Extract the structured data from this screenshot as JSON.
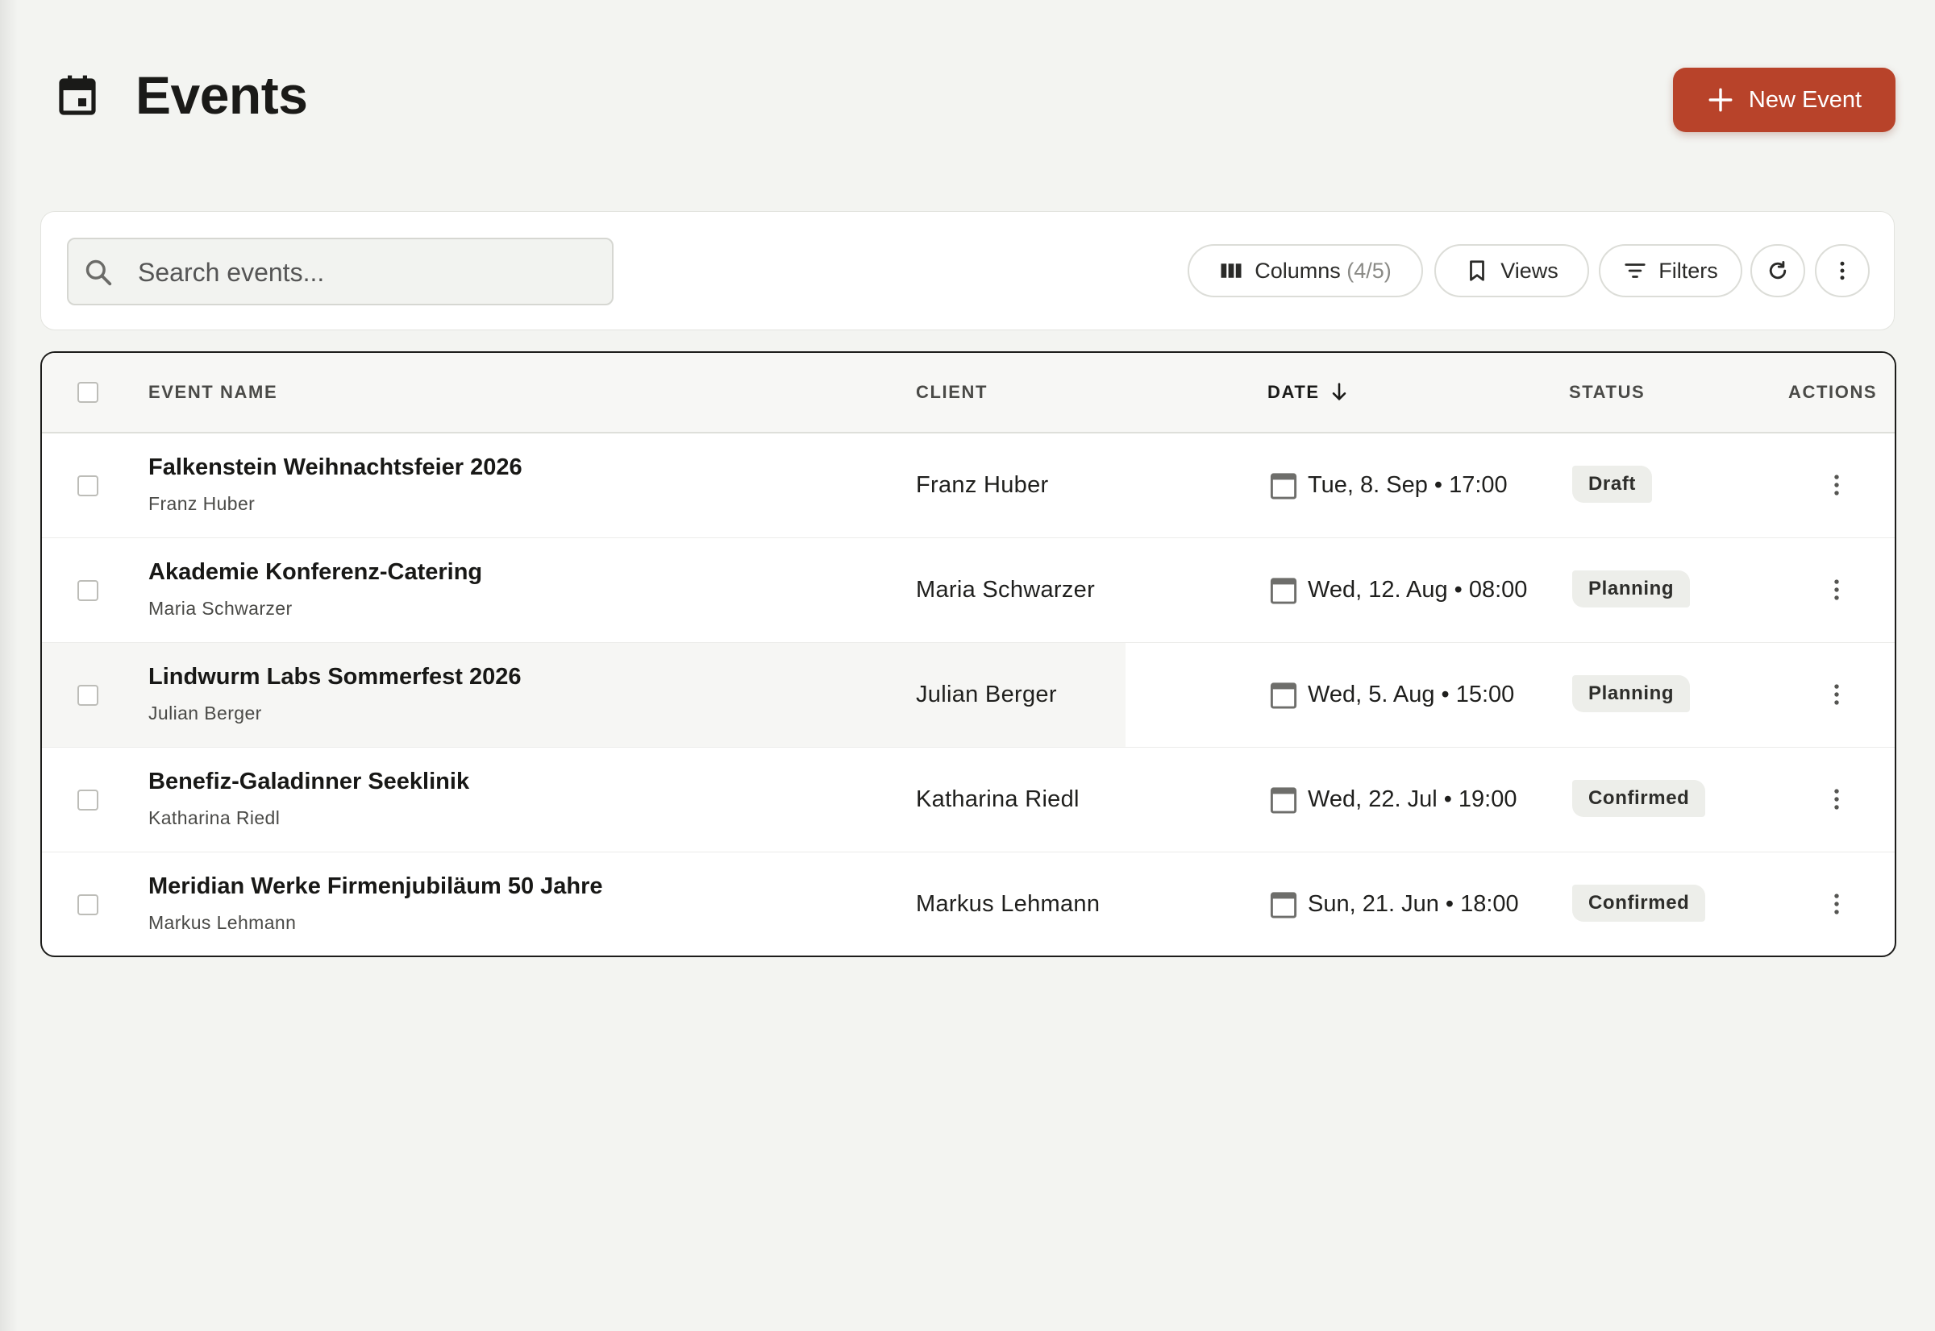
{
  "header": {
    "title": "Events",
    "new_button_label": "New Event"
  },
  "toolbar": {
    "search_placeholder": "Search events...",
    "columns_label": "Columns",
    "columns_count": "(4/5)",
    "views_label": "Views",
    "filters_label": "Filters"
  },
  "table": {
    "columns": {
      "event_name": "EVENT NAME",
      "client": "CLIENT",
      "date": "DATE",
      "status": "STATUS",
      "actions": "ACTIONS"
    },
    "sort": {
      "column": "date",
      "direction": "descending"
    },
    "rows": [
      {
        "name": "Falkenstein Weihnachtsfeier 2026",
        "sub": "Franz Huber",
        "client": "Franz Huber",
        "date": "Tue, 8. Sep • 17:00",
        "status": "Draft"
      },
      {
        "name": "Akademie Konferenz-Catering",
        "sub": "Maria Schwarzer",
        "client": "Maria Schwarzer",
        "date": "Wed, 12. Aug • 08:00",
        "status": "Planning"
      },
      {
        "name": "Lindwurm Labs Sommerfest 2026",
        "sub": "Julian Berger",
        "client": "Julian Berger",
        "date": "Wed, 5. Aug • 15:00",
        "status": "Planning"
      },
      {
        "name": "Benefiz-Galadinner Seeklinik",
        "sub": "Katharina Riedl",
        "client": "Katharina Riedl",
        "date": "Wed, 22. Jul • 19:00",
        "status": "Confirmed"
      },
      {
        "name": "Meridian Werke Firmenjubiläum 50 Jahre",
        "sub": "Markus Lehmann",
        "client": "Markus Lehmann",
        "date": "Sun, 21. Jun • 18:00",
        "status": "Confirmed"
      }
    ]
  },
  "colors": {
    "accent": "#b8432a",
    "background": "#f3f4f1",
    "badge_bg": "#edeeea"
  },
  "icons": {
    "header": "calendar-icon",
    "new_button": "plus-icon",
    "search": "search-icon",
    "columns": "columns-icon",
    "views": "bookmark-icon",
    "filters": "filter-icon",
    "refresh": "refresh-icon",
    "more": "more-vertical-icon",
    "sort": "arrow-down-icon",
    "date": "calendar-icon",
    "row_action": "more-vertical-icon"
  }
}
